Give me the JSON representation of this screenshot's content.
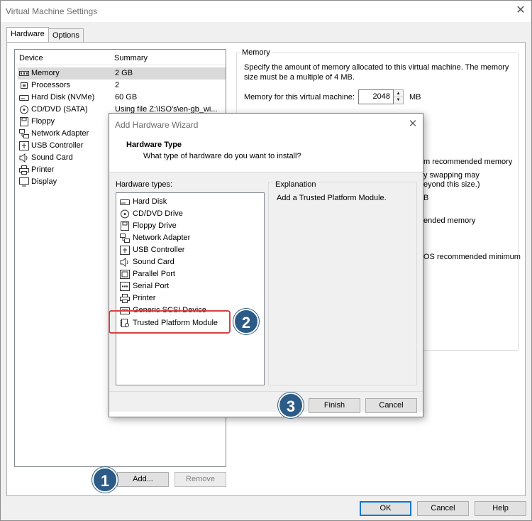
{
  "window": {
    "title": "Virtual Machine Settings",
    "close": "✕"
  },
  "tabs": [
    "Hardware",
    "Options"
  ],
  "device_list": {
    "col_device": "Device",
    "col_summary": "Summary",
    "rows": [
      {
        "icon": "memory-icon",
        "name": "Memory",
        "summary": "2 GB"
      },
      {
        "icon": "processor-icon",
        "name": "Processors",
        "summary": "2"
      },
      {
        "icon": "hard-disk-icon",
        "name": "Hard Disk (NVMe)",
        "summary": "60 GB"
      },
      {
        "icon": "cd-dvd-icon",
        "name": "CD/DVD (SATA)",
        "summary": "Using file Z:\\ISO's\\en-gb_wi..."
      },
      {
        "icon": "floppy-icon",
        "name": "Floppy",
        "summary": ""
      },
      {
        "icon": "network-adapter-icon",
        "name": "Network Adapter",
        "summary": ""
      },
      {
        "icon": "usb-controller-icon",
        "name": "USB Controller",
        "summary": ""
      },
      {
        "icon": "sound-card-icon",
        "name": "Sound Card",
        "summary": ""
      },
      {
        "icon": "printer-icon",
        "name": "Printer",
        "summary": ""
      },
      {
        "icon": "display-icon",
        "name": "Display",
        "summary": ""
      }
    ],
    "add_label": "Add...",
    "remove_label": "Remove"
  },
  "memory": {
    "group_title": "Memory",
    "description": "Specify the amount of memory allocated to this virtual machine. The memory size must be a multiple of 4 MB.",
    "field_label": "Memory for this virtual machine:",
    "value": "2048",
    "unit": "MB",
    "partial_texts": [
      "m recommended memory",
      "y swapping may",
      "eyond this size.)",
      "B",
      "ended memory",
      "OS recommended minimum"
    ]
  },
  "wizard": {
    "title": "Add Hardware Wizard",
    "heading": "Hardware Type",
    "subheading": "What type of hardware do you want to install?",
    "list_label": "Hardware types:",
    "items": [
      {
        "icon": "hard-disk-icon",
        "label": "Hard Disk"
      },
      {
        "icon": "cd-dvd-icon",
        "label": "CD/DVD Drive"
      },
      {
        "icon": "floppy-icon",
        "label": "Floppy Drive"
      },
      {
        "icon": "network-adapter-icon",
        "label": "Network Adapter"
      },
      {
        "icon": "usb-controller-icon",
        "label": "USB Controller"
      },
      {
        "icon": "sound-card-icon",
        "label": "Sound Card"
      },
      {
        "icon": "parallel-port-icon",
        "label": "Parallel Port"
      },
      {
        "icon": "serial-port-icon",
        "label": "Serial Port"
      },
      {
        "icon": "printer-icon",
        "label": "Printer"
      },
      {
        "icon": "scsi-device-icon",
        "label": "Generic SCSI Device"
      },
      {
        "icon": "tpm-icon",
        "label": "Trusted Platform Module"
      }
    ],
    "explanation_title": "Explanation",
    "explanation_text": "Add a Trusted Platform Module.",
    "finish_label": "Finish",
    "cancel_label": "Cancel"
  },
  "footer": {
    "ok_label": "OK",
    "cancel_label": "Cancel",
    "help_label": "Help"
  },
  "callouts": [
    "1",
    "2",
    "3"
  ],
  "colors": {
    "callout": "#2b5b86",
    "highlight": "#d64242",
    "focus": "#0078d7"
  }
}
